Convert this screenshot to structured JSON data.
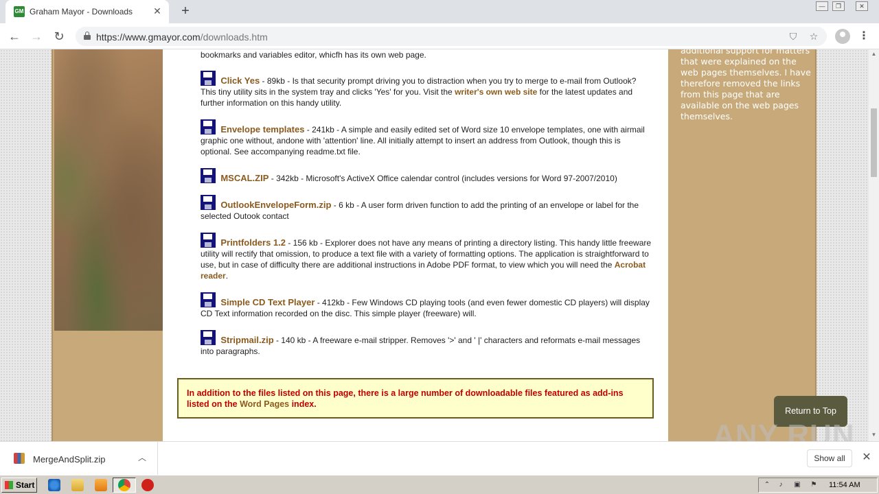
{
  "browser": {
    "tab_title": "Graham Mayor - Downloads",
    "favicon_text": "GM",
    "url_host": "https://www.gmayor.com",
    "url_path": "/downloads.htm"
  },
  "page": {
    "top_line": "bookmarks and variables editor, whicfh has its own web page.",
    "entries": [
      {
        "name": "Click Yes",
        "text_before": " - 89kb -  Is that security prompt driving you to distraction when you try to merge to e-mail from Outlook? This tiny utility sits in the system tray and clicks 'Yes' for you. Visit the ",
        "link": "writer's own web site",
        "text_after": " for the latest updates and further information on this handy utility."
      },
      {
        "name": "Envelope templates",
        "text_before": " - 241kb - A simple and easily edited set of Word size 10 envelope templates, one with airmail graphic one without, andone with 'attention' line. All initially attempt to insert an address from Outlook, though this is optional. See accompanying readme.txt file.",
        "link": "",
        "text_after": ""
      },
      {
        "name": "MSCAL.ZIP",
        "text_before": " - 342kb - Microsoft's ActiveX Office calendar control (includes versions for Word 97-2007/2010)",
        "link": "",
        "text_after": ""
      },
      {
        "name": "OutlookEnvelopeForm.zip",
        "text_before": " - 6 kb - A user form driven function to add the printing of an envelope or label for the selected Outook contact",
        "link": "",
        "text_after": ""
      },
      {
        "name": "Printfolders 1.2",
        "text_before": " - 156 kb -  Explorer does not have any means of printing a directory listing. This handy little freeware utility will rectify that omission, to produce a text file with a variety of formatting options. The application is straightforward to use, but in case of difficulty there are additional instructions in Adobe PDF format, to view which you will need the ",
        "link": "Acrobat reader",
        "text_after": "."
      },
      {
        "name": "Simple CD Text Player",
        "text_before": " -  412kb - Few Windows CD playing tools (and even fewer domestic CD players) will display CD Text information recorded on the disc. This simple player (freeware) will.",
        "link": "",
        "text_after": ""
      },
      {
        "name": "Stripmail.zip",
        "text_before": " - 140 kb - A freeware e-mail stripper. Removes '>' and ' |'  characters and reformats e-mail messages into paragraphs.",
        "link": "",
        "text_after": ""
      }
    ],
    "notice_before": "In addition to the files listed on this page, there is a large number of downloadable files featured as add-ins listed on the ",
    "notice_link": "Word Pages",
    "notice_after": " index.",
    "sidebar_text": "additional support for matters that were explained on the web pages themselves. I have therefore removed the links from this page that are available on the  web pages themselves.",
    "back_to_top": "Return to Top",
    "watermark": "ANY RUN"
  },
  "downloads": {
    "file_name": "MergeAndSplit.zip",
    "show_all": "Show all"
  },
  "taskbar": {
    "start": "Start",
    "clock": "11:54 AM"
  },
  "colors": {
    "link": "#8b5a1e",
    "notice_text": "#c00000",
    "notice_bg": "#ffffcc",
    "column_bg": "#c8a97a",
    "floppy": "#14137a"
  }
}
